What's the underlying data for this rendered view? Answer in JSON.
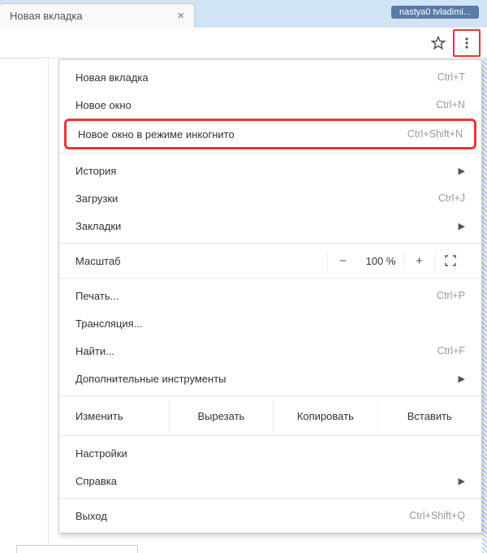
{
  "tab": {
    "title": "Новая вкладка"
  },
  "user_pill": "nastya0 tvladimi...",
  "menu": {
    "new_tab": {
      "label": "Новая вкладка",
      "shortcut": "Ctrl+T"
    },
    "new_window": {
      "label": "Новое окно",
      "shortcut": "Ctrl+N"
    },
    "incognito": {
      "label": "Новое окно в режиме инкогнито",
      "shortcut": "Ctrl+Shift+N"
    },
    "history": {
      "label": "История"
    },
    "downloads": {
      "label": "Загрузки",
      "shortcut": "Ctrl+J"
    },
    "bookmarks": {
      "label": "Закладки"
    },
    "zoom_label": "Масштаб",
    "zoom_value": "100 %",
    "print": {
      "label": "Печать...",
      "shortcut": "Ctrl+P"
    },
    "cast": {
      "label": "Трансляция..."
    },
    "find": {
      "label": "Найти...",
      "shortcut": "Ctrl+F"
    },
    "more_tools": {
      "label": "Дополнительные инструменты"
    },
    "edit_label": "Изменить",
    "cut": "Вырезать",
    "copy": "Копировать",
    "paste": "Вставить",
    "settings": {
      "label": "Настройки"
    },
    "help": {
      "label": "Справка"
    },
    "exit": {
      "label": "Выход",
      "shortcut": "Ctrl+Shift+Q"
    }
  }
}
